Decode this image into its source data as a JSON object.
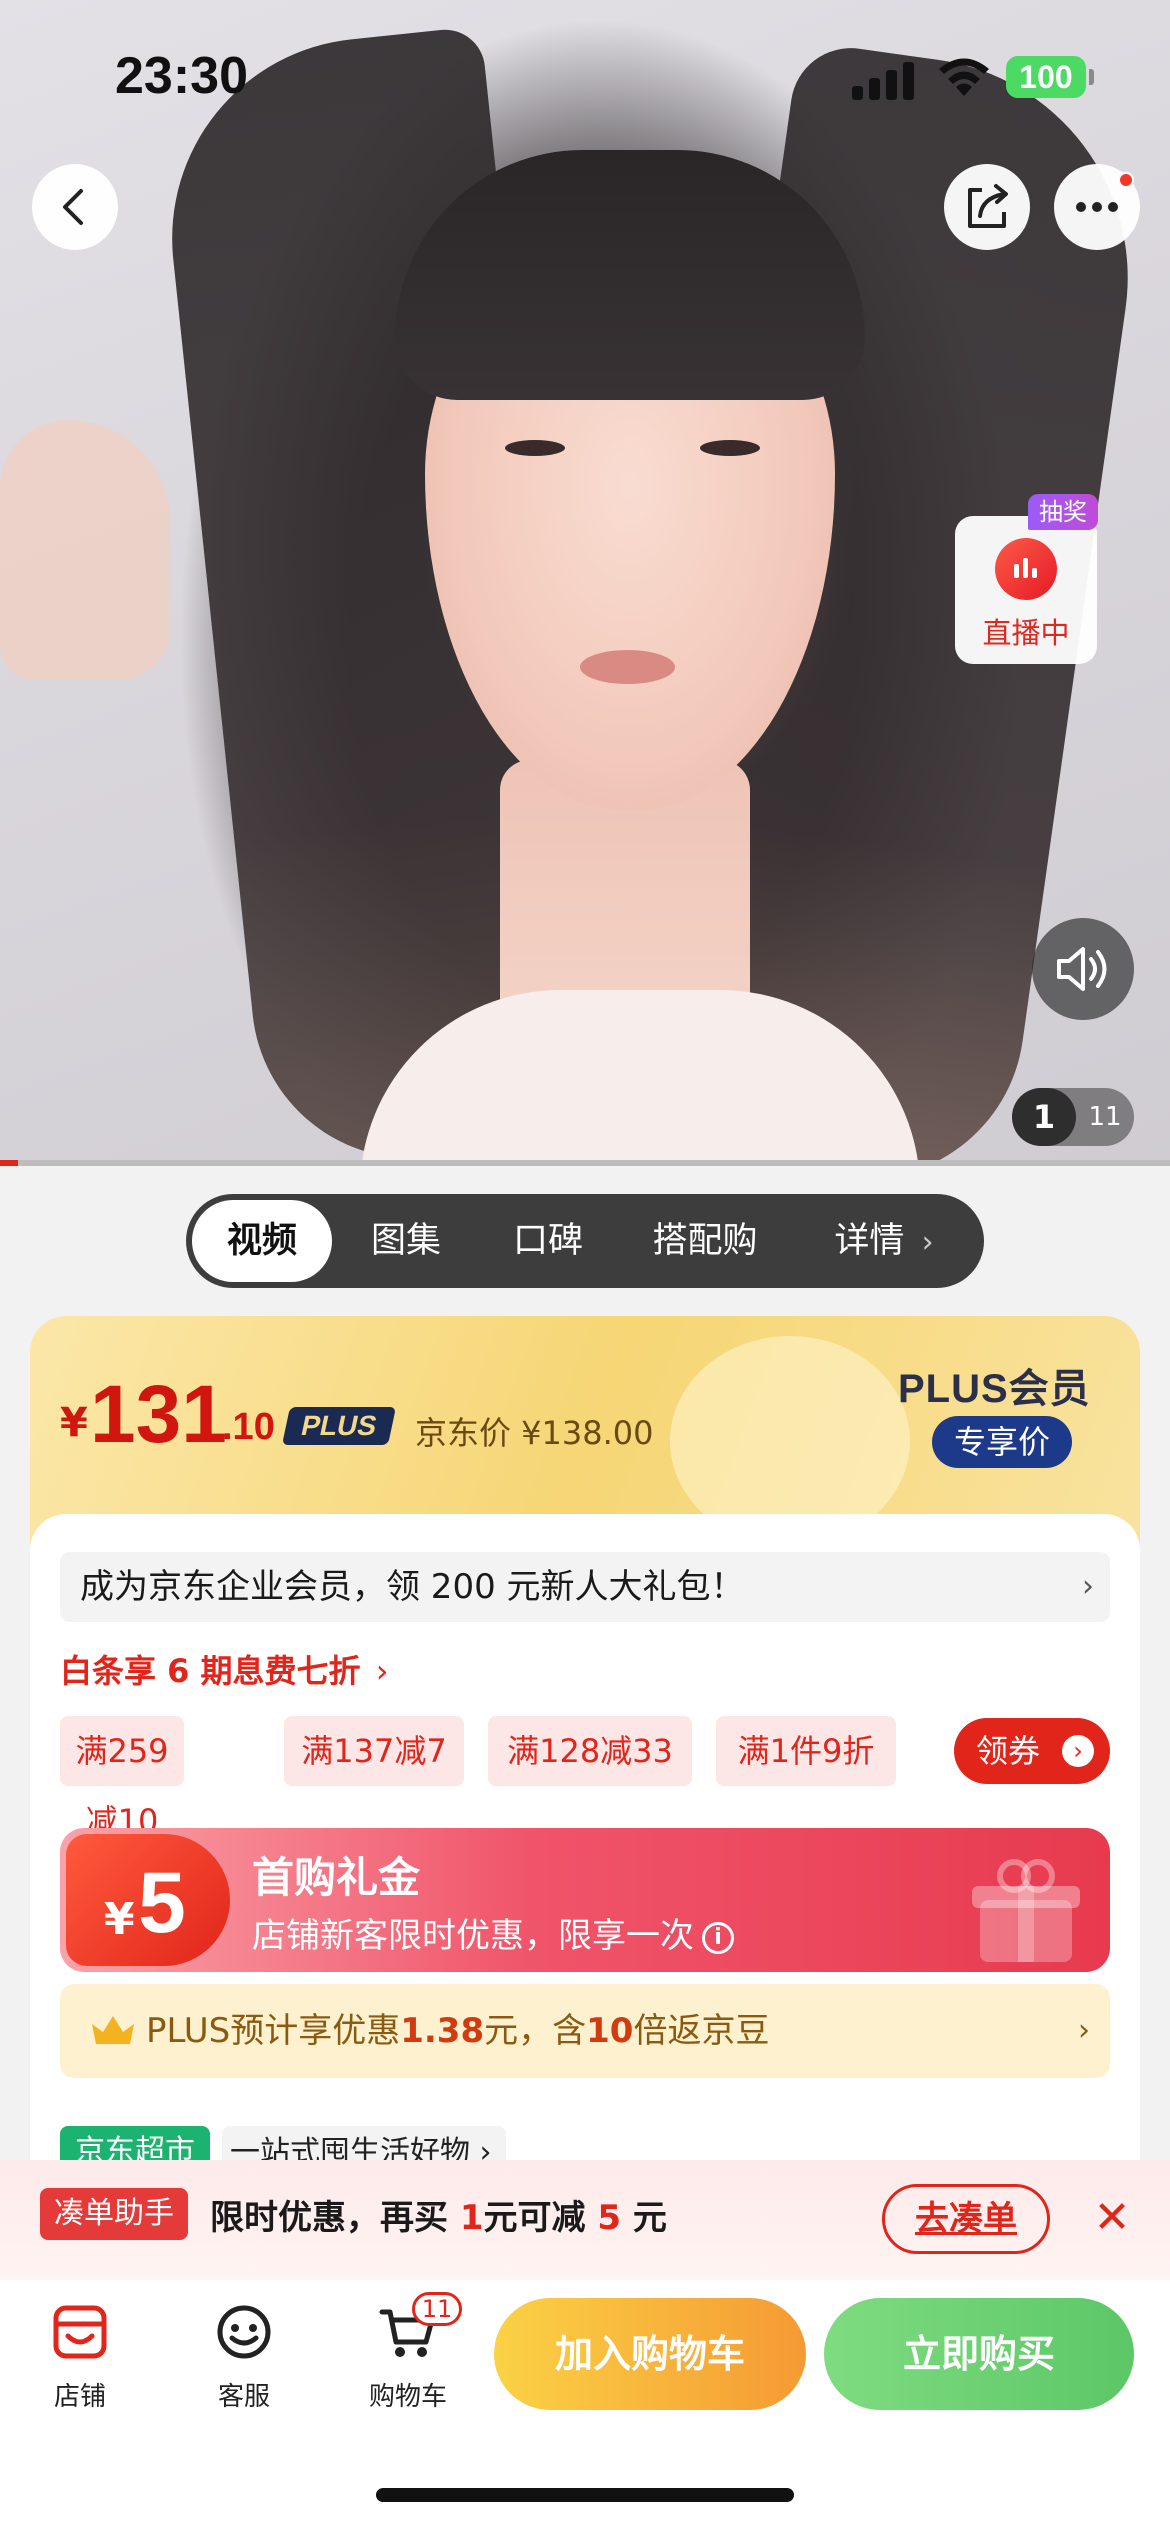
{
  "status_bar": {
    "time": "23:30",
    "battery": "100"
  },
  "hero": {
    "live": {
      "badge": "抽奖",
      "label": "直播中"
    },
    "counter": {
      "current": "1",
      "total": "11"
    },
    "video_progress": 0.015
  },
  "tabs": [
    {
      "label": "视频",
      "active": true
    },
    {
      "label": "图集"
    },
    {
      "label": "口碑"
    },
    {
      "label": "搭配购"
    },
    {
      "label": "详情"
    }
  ],
  "price": {
    "yen": "¥",
    "integer": "131",
    "decimal": ".10",
    "plus_tag": "PLUS",
    "jd_price": "京东价 ¥138.00",
    "plus_member": "PLUS会员",
    "exclusive": "专享价"
  },
  "promo": {
    "enterprise": "成为京东企业会员，领 200 元新人大礼包！",
    "baitiao": "白条享 6 期息费七折",
    "coupons": [
      "满259减10",
      "满137减7",
      "满128减33",
      "满1件9折"
    ],
    "get_coupon": "领券",
    "first_buy": {
      "yen": "¥",
      "amount": "5",
      "title": "首购礼金",
      "desc": "店铺新客限时优惠，限享一次"
    },
    "plus_bar": {
      "prefix": "PLUS预计享优惠",
      "amount": "1.38",
      "mid": "元，含",
      "times": "10",
      "suffix": "倍返京豆"
    },
    "supermarket": "京东超市",
    "one_stop": "一站式囤生活好物"
  },
  "bundle": {
    "tag": "凑单助手",
    "msg_a": "限时优惠，再买",
    "num_a": "1",
    "msg_b": "元可减",
    "num_b": "5",
    "msg_c": "元",
    "go": "去凑单"
  },
  "bottom_bar": {
    "store": "店铺",
    "service": "客服",
    "cart": "购物车",
    "cart_count": "11",
    "add_cart": "加入购物车",
    "buy_now": "立即购买"
  },
  "colors": {
    "accent_red": "#e1251b",
    "plus_navy": "#1d3a8a",
    "buy_green": "#5cc767",
    "cart_orange": "#f59a33"
  }
}
